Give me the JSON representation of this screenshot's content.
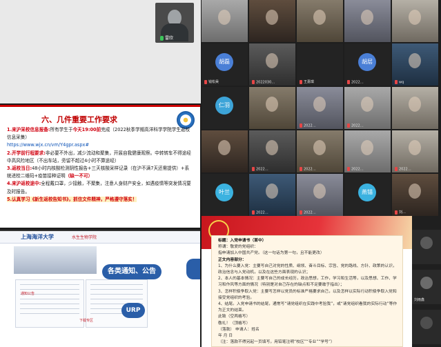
{
  "self_view": {
    "name": "雷欣"
  },
  "slide": {
    "title": "六、几件重要工作要求",
    "lines": [
      {
        "num": "1.",
        "head": "来沪采校信息报备:",
        "text": "所有学生于",
        "red_inline": "今天19:00前",
        "tail": "完成（2022秋季学期高洋科学学院学生返校信息采集）"
      },
      {
        "num": "",
        "head": "",
        "text": "https://www.wjx.cn/vm/Y4gpr.aspx#",
        "red_inline": "",
        "tail": ""
      },
      {
        "num": "2.",
        "head": "开学前行程要求:",
        "text": "非必要不外出，减少流动和聚集，开展自我健康观察。中转转车不得途经中高风险地区（不出车站，旁留不超过4小时不算途经）",
        "red_inline": "",
        "tail": ""
      },
      {
        "num": "3.",
        "head": "返校当日:",
        "text": "48小时内核酸检测阴性报告+三天核酸采样记录（在沪不满7天还需提供）+系统进校二维码+疫苗接种证明",
        "red_inline": "（缺一不可）",
        "tail": ""
      },
      {
        "num": "4.",
        "head": "来沪返校途中:",
        "text": "全程戴口罩，少接触，不聚集，注意人身财产安全，如遇疫情等突发情况要及时报告。",
        "red_inline": "",
        "tail": ""
      },
      {
        "num": "5.",
        "head": "",
        "text": "认真学习《新生返校告知书》，抓住文件精神，严格遵守落实！",
        "red_inline": "",
        "tail": ""
      }
    ]
  },
  "grid": {
    "tiles": [
      {
        "name": "",
        "avatar_text": "",
        "style": "photo1",
        "avatar_color": ""
      },
      {
        "name": "",
        "avatar_text": "",
        "style": "photo2",
        "avatar_color": ""
      },
      {
        "name": "",
        "avatar_text": "",
        "style": "photo3",
        "avatar_color": ""
      },
      {
        "name": "",
        "avatar_text": "",
        "style": "photo4",
        "avatar_color": ""
      },
      {
        "name": "",
        "avatar_text": "",
        "style": "photo5",
        "avatar_color": ""
      },
      {
        "name": "钱松昊",
        "avatar_text": "胡磊",
        "style": "dark",
        "avatar_color": "#4a7fd6"
      },
      {
        "name": "2022030…",
        "avatar_text": "",
        "style": "photo6",
        "avatar_color": ""
      },
      {
        "name": "王嘉琪",
        "avatar_text": "",
        "style": "dark",
        "avatar_color": ""
      },
      {
        "name": "2022…",
        "avatar_text": "胡层",
        "style": "dark",
        "avatar_color": "#4a7fd6"
      },
      {
        "name": "wq",
        "avatar_text": "",
        "style": "photo7",
        "avatar_color": ""
      },
      {
        "name": "",
        "avatar_text": "仁羽",
        "style": "dark",
        "avatar_color": "#3da4d8"
      },
      {
        "name": "",
        "avatar_text": "",
        "style": "photo3",
        "avatar_color": ""
      },
      {
        "name": "2022…",
        "avatar_text": "",
        "style": "photo4",
        "avatar_color": ""
      },
      {
        "name": "2022…",
        "avatar_text": "",
        "style": "photo1",
        "avatar_color": ""
      },
      {
        "name": "",
        "avatar_text": "",
        "style": "photo5",
        "avatar_color": ""
      },
      {
        "name": "",
        "avatar_text": "",
        "style": "photo2",
        "avatar_color": ""
      },
      {
        "name": "2022…",
        "avatar_text": "",
        "style": "photo6",
        "avatar_color": ""
      },
      {
        "name": "2022…",
        "avatar_text": "",
        "style": "photo3",
        "avatar_color": ""
      },
      {
        "name": "2022…",
        "avatar_text": "",
        "style": "photo1",
        "avatar_color": ""
      },
      {
        "name": "2022…",
        "avatar_text": "",
        "style": "photo5",
        "avatar_color": ""
      },
      {
        "name": "",
        "avatar_text": "叶兰",
        "style": "dark",
        "avatar_color": "#3bb2e0"
      },
      {
        "name": "2022…",
        "avatar_text": "",
        "style": "photo7",
        "avatar_color": ""
      },
      {
        "name": "2022…",
        "avatar_text": "",
        "style": "photo4",
        "avatar_color": ""
      },
      {
        "name": "",
        "avatar_text": "燕锚",
        "style": "dark",
        "avatar_color": "#3bb2e0"
      },
      {
        "name": "刘…",
        "avatar_text": "",
        "style": "photo2",
        "avatar_color": ""
      }
    ]
  },
  "site": {
    "logo": "上海海洋大学",
    "subtitle": "水生生物学院",
    "callout_notice": "各类通知、公告",
    "callout_urp": "URP",
    "label1": "通知公告",
    "label2": "下载专区"
  },
  "doc": {
    "lines": [
      {
        "bold": true,
        "text": "标题：入党申请书（首中）"
      },
      {
        "bold": false,
        "text": "称谓：敬爱的党组织："
      },
      {
        "bold": false,
        "text": "指申请加入中国共产党。（这一句话为第一句，且不能更改）"
      },
      {
        "bold": true,
        "text": "正文内容部分："
      },
      {
        "bold": false,
        "text": "1、为什么要入党：主要写自己对党的性质、纲领、奋斗目标、宗旨、党的路线、方针、政策的认识，政治信念与入党动机，以及在这些方面表现的认识；"
      },
      {
        "bold": false,
        "text": "2、本人的基本情况：主要写自己的成长经历，政治思想，工作，学习和生活等，以及思想、工作、学习和作风等方面的情况（特别是对自己存在的缺点和不足要敢于指出）；"
      },
      {
        "bold": false,
        "text": "3、怎样积极争取入党：主要写怎样以党员的标准严格要求自己，以及怎样以实际行动积极争取入党和接受党组织的考验。"
      },
      {
        "bold": false,
        "text": "4、结尾。入党申请书的结尾，通常写“请党组织在实践中考验我”，或“请党组织看我的实际行动”等作为正文的结束。"
      },
      {
        "bold": false,
        "text": "此致（空两格写）"
      },
      {
        "bold": false,
        "text": "敬礼！（顶格写）"
      },
      {
        "bold": false,
        "text": "（落款）  申请人：姓名"
      },
      {
        "bold": false,
        "text": "年  月  日"
      },
      {
        "bold": false,
        "text": "（注：落款不得另起一页填写，用铅笔注明“校区”“专业”“学号”）"
      }
    ]
  },
  "right_strip": [
    {
      "name": "",
      "avatar_color": "#5a5a5a"
    },
    {
      "name": "刘雨鑫",
      "avatar_color": "#6b6b6b"
    },
    {
      "name": "",
      "avatar_color": "#4e4e4e"
    }
  ]
}
